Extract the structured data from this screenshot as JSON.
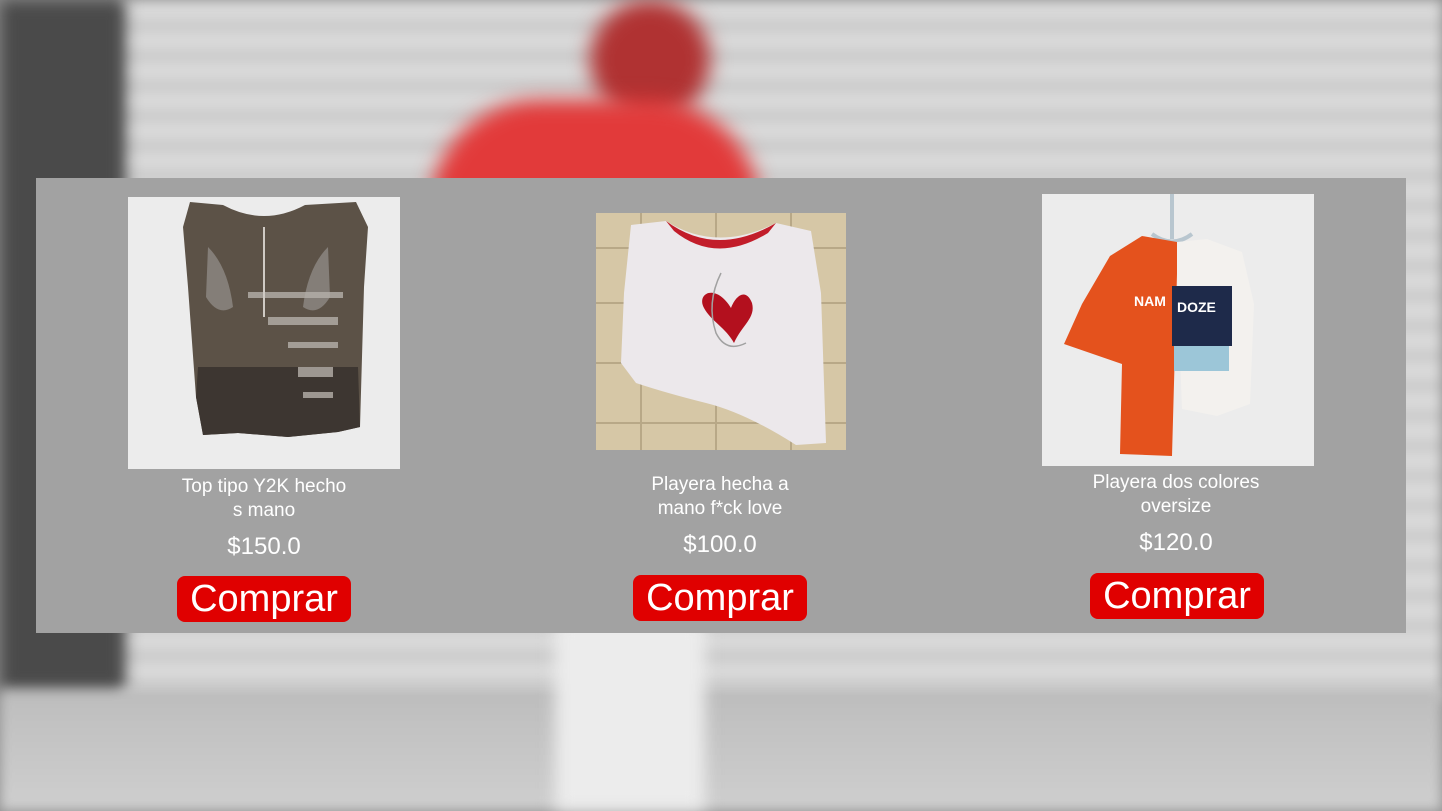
{
  "products": [
    {
      "title_line1": "Top tipo Y2K hecho",
      "title_line2": "s mano",
      "price": "$150.0",
      "button_label": "Comprar"
    },
    {
      "title_line1": "Playera hecha a",
      "title_line2": "mano f*ck love",
      "price": "$100.0",
      "button_label": "Comprar"
    },
    {
      "title_line1": "Playera dos colores",
      "title_line2": "oversize",
      "price": "$120.0",
      "button_label": "Comprar"
    }
  ],
  "colors": {
    "panel": "#a2a2a2",
    "button": "#e00000",
    "text": "#ffffff"
  }
}
